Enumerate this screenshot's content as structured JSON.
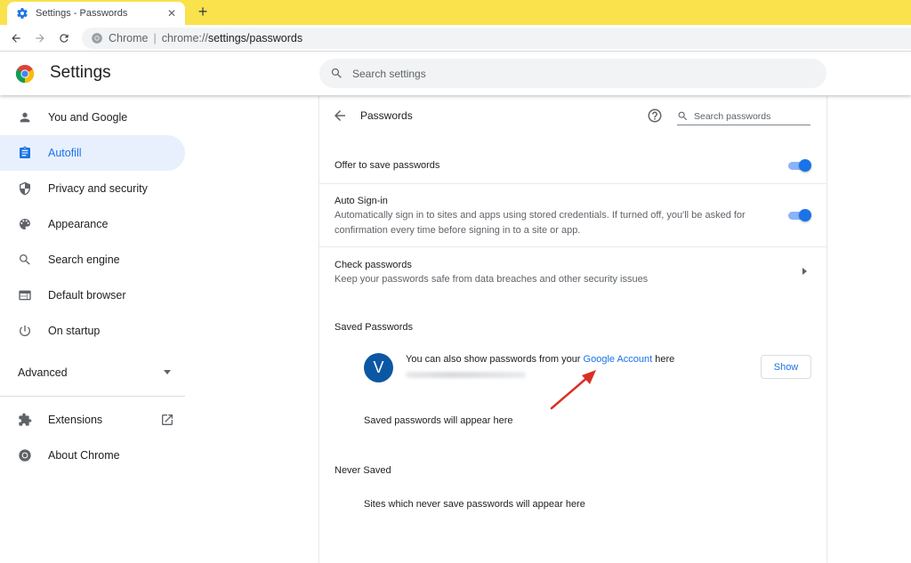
{
  "browser": {
    "tab_title": "Settings - Passwords",
    "close_glyph": "✕",
    "newtab_glyph": "+",
    "omnibox": {
      "site_chip": "Chrome",
      "separator": "|",
      "url_scheme": "chrome://",
      "url_path": "settings/passwords"
    }
  },
  "header": {
    "title": "Settings",
    "search_placeholder": "Search settings"
  },
  "sidebar": {
    "items": [
      {
        "label": "You and Google",
        "icon": "person-icon"
      },
      {
        "label": "Autofill",
        "icon": "clipboard-icon",
        "active": true
      },
      {
        "label": "Privacy and security",
        "icon": "shield-icon"
      },
      {
        "label": "Appearance",
        "icon": "palette-icon"
      },
      {
        "label": "Search engine",
        "icon": "search-icon"
      },
      {
        "label": "Default browser",
        "icon": "browser-window-icon"
      },
      {
        "label": "On startup",
        "icon": "power-icon"
      }
    ],
    "advanced_label": "Advanced",
    "extensions_label": "Extensions",
    "about_label": "About Chrome"
  },
  "passwords": {
    "title": "Passwords",
    "search_placeholder": "Search passwords",
    "offer_to_save": {
      "label": "Offer to save passwords",
      "enabled": true
    },
    "auto_signin": {
      "label": "Auto Sign-in",
      "description": "Automatically sign in to sites and apps using stored credentials. If turned off, you'll be asked for confirmation every time before signing in to a site or app.",
      "enabled": true
    },
    "check": {
      "label": "Check passwords",
      "description": "Keep your passwords safe from data breaches and other security issues"
    },
    "saved_heading": "Saved Passwords",
    "account": {
      "avatar_letter": "V",
      "text_before": "You can also show passwords from your ",
      "link_text": "Google Account",
      "text_after": " here",
      "show_button": "Show"
    },
    "saved_empty": "Saved passwords will appear here",
    "never_heading": "Never Saved",
    "never_empty": "Sites which never save passwords will appear here"
  },
  "colors": {
    "tabstrip": "#f9e24c",
    "accent": "#1a73e8",
    "active_nav_bg": "#e8f0fe",
    "annotation_arrow": "#d93025"
  }
}
